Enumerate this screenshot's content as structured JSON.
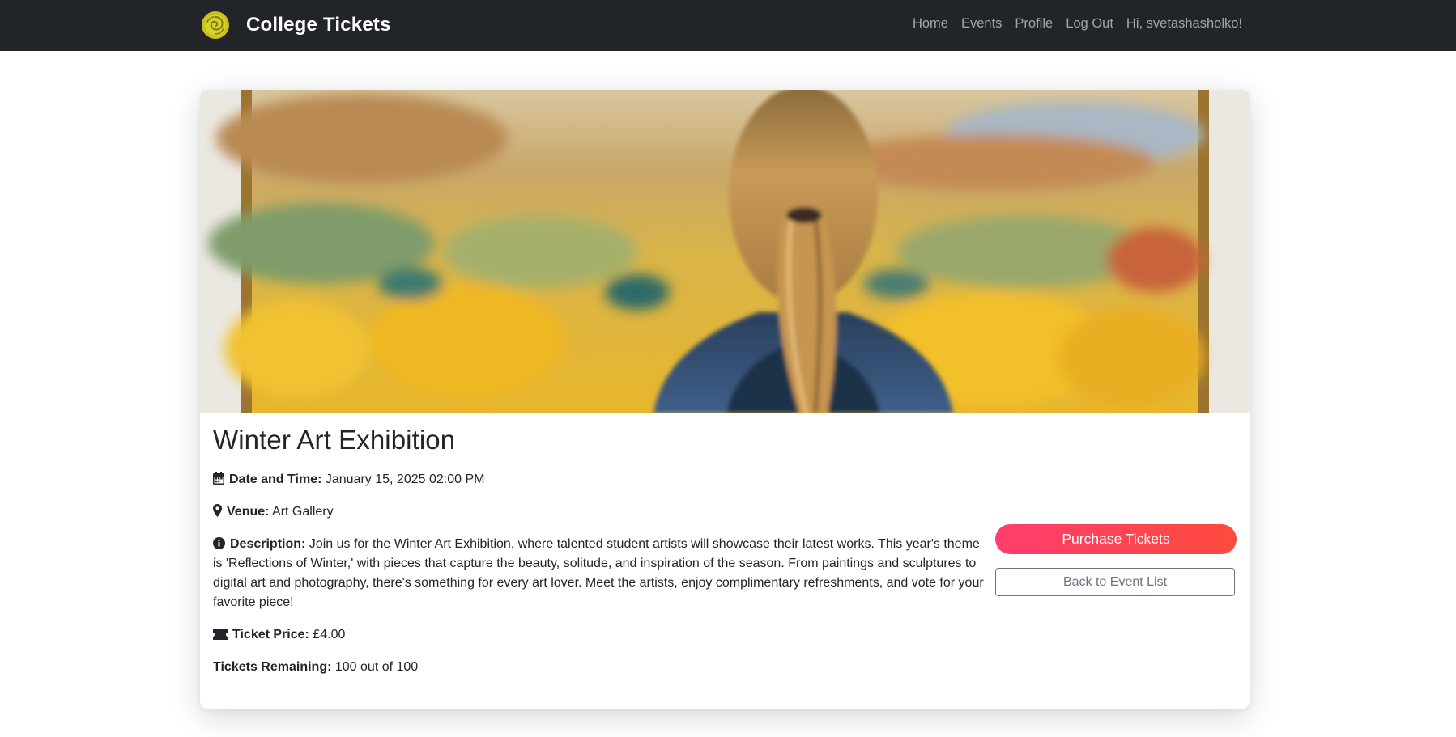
{
  "navbar": {
    "brand": "College Tickets",
    "links": [
      "Home",
      "Events",
      "Profile",
      "Log Out"
    ],
    "greeting": "Hi, svetashasholko!"
  },
  "event": {
    "title": "Winter Art Exhibition",
    "date_label": "Date and Time:",
    "date_value": "January 15, 2025 02:00 PM",
    "venue_label": "Venue:",
    "venue_value": "Art Gallery",
    "description_label": "Description:",
    "description_value": "Join us for the Winter Art Exhibition, where talented student artists will showcase their latest works. This year's theme is 'Reflections of Winter,' with pieces that capture the beauty, solitude, and inspiration of the season. From paintings and sculptures to digital art and photography, there's something for every art lover. Meet the artists, enjoy complimentary refreshments, and vote for your favorite piece!",
    "price_label": "Ticket Price:",
    "price_value": "£4.00",
    "remaining_label": "Tickets Remaining:",
    "remaining_value": "100 out of 100"
  },
  "actions": {
    "purchase": "Purchase Tickets",
    "back": "Back to Event List"
  },
  "icons": {
    "brand": "spiral-logo-icon",
    "date": "calendar-icon",
    "venue": "map-marker-icon",
    "description": "info-circle-icon",
    "price": "ticket-icon"
  },
  "colors": {
    "navbar": "#212529",
    "purchase_gradient_start": "#ff3d6e",
    "purchase_gradient_end": "#ff4a3d",
    "secondary": "#6c757d",
    "logo": "#c8c21a"
  }
}
